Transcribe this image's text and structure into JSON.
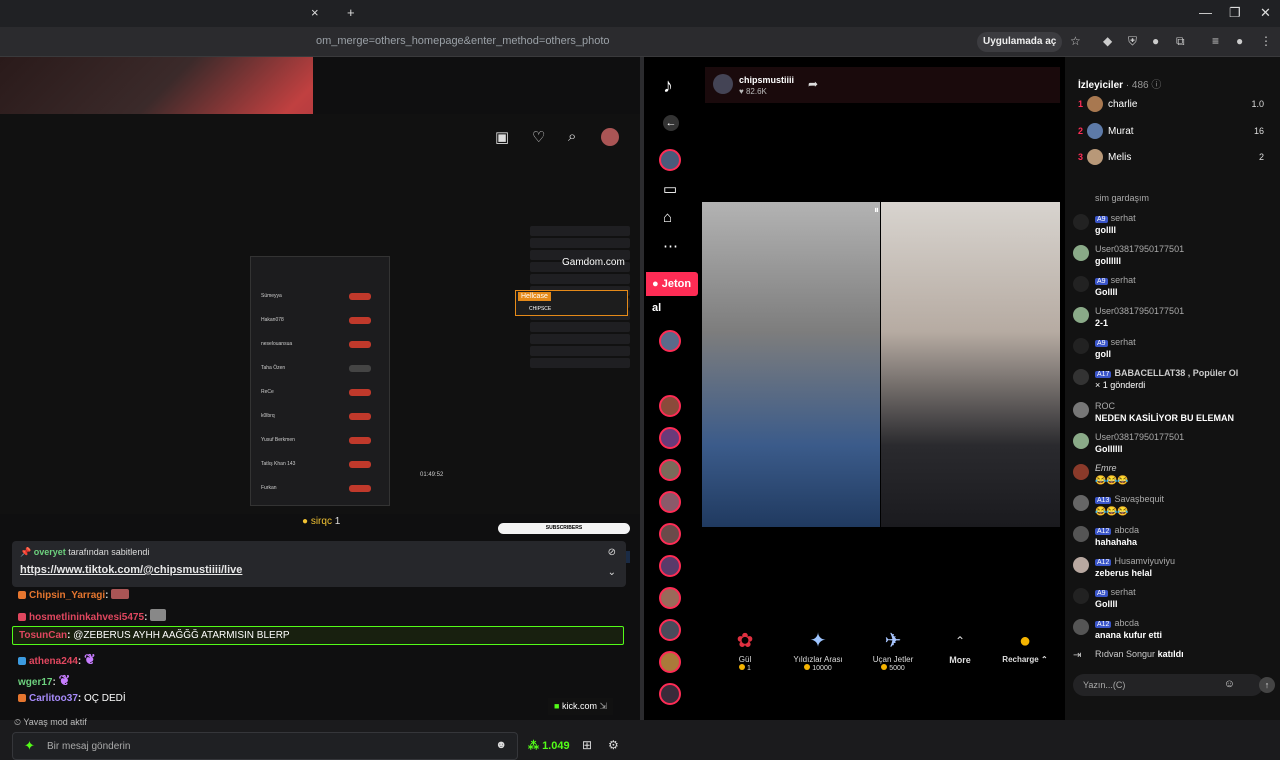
{
  "browser": {
    "url": "om_merge=others_homepage&enter_method=others_photo",
    "open_in_app": "Uygulamada aç",
    "tab_close": "×",
    "new_tab": "+",
    "win_min": "—",
    "win_max": "❐",
    "win_close": "✕"
  },
  "kick": {
    "viewer_count": "sirqc",
    "viewer_num": "1",
    "pinned_by_user": "overyet",
    "pinned_by_suffix": "tarafından sabitlendi",
    "pinned_link": "https://www.tiktok.com/@chipsmustiiii/live",
    "chat": [
      {
        "user": "Chipsin_Yarragi",
        "text": "",
        "color": "#e6762f"
      },
      {
        "user": "hosmetlininkahvesi5475",
        "text": "",
        "color": "#e0475f"
      },
      {
        "user": "TosunCan",
        "text": "@ZEBERUS AYHH AAĞĞĞ ATARMISIN BLERP",
        "color": "#e0475f"
      },
      {
        "user": "athena244",
        "text": "",
        "color": "#e0475f"
      },
      {
        "user": "wger17",
        "text": "",
        "color": "#6dd17e"
      },
      {
        "user": "Carlitoo37",
        "text": "OÇ DEDİ",
        "color": "#a78bfa"
      }
    ],
    "slow_mode": "Yavaş mod aktif",
    "message_placeholder": "Bir mesaj gönderin",
    "points": "1.049",
    "kick_domain": "kick.com",
    "stream_inner": {
      "gamdom": "Gamdom.com",
      "hellcase": "Hellcase",
      "hellcase_code": "CHIPSCE",
      "subscribers": "SUBSCRIBERS",
      "timer": "01:49:52"
    }
  },
  "tiktok": {
    "streamer": "chipsmustiiii",
    "likes": "82.6K",
    "jeton": "Jeton al",
    "gifts": [
      {
        "name": "Gül",
        "price": "1",
        "icon": "rose-icon"
      },
      {
        "name": "Yıldızlar Arası",
        "price": "10000",
        "icon": "spaceship-icon"
      },
      {
        "name": "Uçan Jetler",
        "price": "5000",
        "icon": "jets-icon"
      },
      {
        "name": "More",
        "price": "",
        "icon": "chevron-up-icon"
      },
      {
        "name": "Recharge",
        "price": "",
        "icon": "coin-icon"
      }
    ],
    "viewers_label": "İzleyiciler",
    "viewers_count": "· 486",
    "top": [
      {
        "rank": "1",
        "name": "charlie",
        "value": "1.0"
      },
      {
        "rank": "2",
        "name": "Murat",
        "value": "16"
      },
      {
        "rank": "3",
        "name": "Melis",
        "value": "2"
      }
    ],
    "messages": [
      {
        "user": "",
        "level": "",
        "text": "sim gardaşım"
      },
      {
        "user": "serhat",
        "level": "9",
        "text": "gollll"
      },
      {
        "user": "User03817950177501",
        "level": "",
        "text": "gollllll"
      },
      {
        "user": "serhat",
        "level": "9",
        "text": "Gollll"
      },
      {
        "user": "User03817950177501",
        "level": "",
        "text": "2-1"
      },
      {
        "user": "serhat",
        "level": "9",
        "text": "goll"
      },
      {
        "user": "BABACELLAT38 , Popüler Ol",
        "level": "17",
        "text": "× 1 gönderdi"
      },
      {
        "user": "ROC",
        "level": "",
        "text": "NEDEN KASİLİYOR BU ELEMAN"
      },
      {
        "user": "User03817950177501",
        "level": "",
        "text": "Gollllll"
      },
      {
        "user": "Emre",
        "level": "",
        "text": "😂😂😂"
      },
      {
        "user": "Savaşbequit",
        "level": "13",
        "text": "😂😂😂"
      },
      {
        "user": "abcda",
        "level": "12",
        "text": "hahahaha"
      },
      {
        "user": "Husamviyuviyu",
        "level": "12",
        "text": "zeberus helal"
      },
      {
        "user": "serhat",
        "level": "9",
        "text": "Gollll"
      },
      {
        "user": "abcda",
        "level": "12",
        "text": "anana kufur etti"
      },
      {
        "user": "Rıdvan Songur",
        "level": "",
        "text": "katıldı"
      }
    ],
    "input_placeholder": "Yazın...(C)"
  }
}
